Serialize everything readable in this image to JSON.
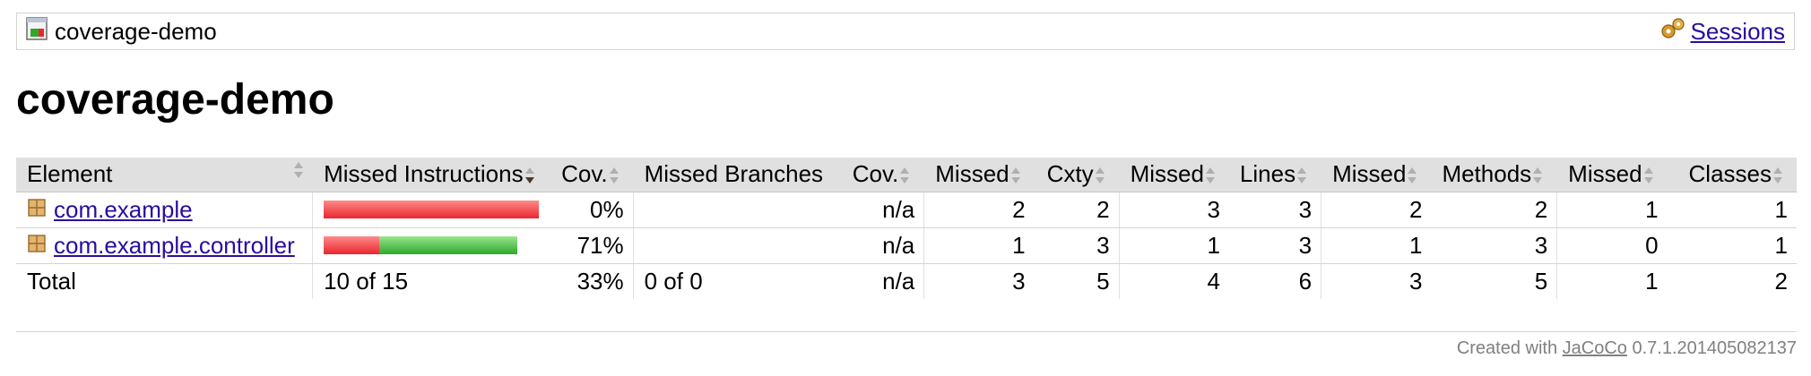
{
  "breadcrumb": {
    "title": "coverage-demo",
    "icon": "report-icon",
    "sessions_label": "Sessions",
    "sessions_icon": "sessions-gear-icon"
  },
  "page_title": "coverage-demo",
  "table": {
    "headers": {
      "element": "Element",
      "missed_instructions": "Missed Instructions",
      "cov_instr": "Cov.",
      "missed_branches": "Missed Branches",
      "cov_branch": "Cov.",
      "missed_cxty": "Missed",
      "cxty": "Cxty",
      "missed_lines": "Missed",
      "lines": "Lines",
      "missed_methods": "Missed",
      "methods": "Methods",
      "missed_classes": "Missed",
      "classes": "Classes"
    },
    "rows": [
      {
        "element": "com.example",
        "icon": "package-icon",
        "instr_missed_fraction": 1.0,
        "cov_instr": "0%",
        "cov_branch": "n/a",
        "missed_cxty": "2",
        "cxty": "2",
        "missed_lines": "3",
        "lines": "3",
        "missed_methods": "2",
        "methods": "2",
        "missed_classes": "1",
        "classes": "1"
      },
      {
        "element": "com.example.controller",
        "icon": "package-icon",
        "instr_missed_fraction": 0.2857,
        "cov_instr": "71%",
        "cov_branch": "n/a",
        "missed_cxty": "1",
        "cxty": "3",
        "missed_lines": "1",
        "lines": "3",
        "missed_methods": "1",
        "methods": "3",
        "missed_classes": "0",
        "classes": "1"
      }
    ],
    "total": {
      "label": "Total",
      "missed_instructions": "10 of 15",
      "cov_instr": "33%",
      "missed_branches": "0 of 0",
      "cov_branch": "n/a",
      "missed_cxty": "3",
      "cxty": "5",
      "missed_lines": "4",
      "lines": "6",
      "missed_methods": "3",
      "methods": "5",
      "missed_classes": "1",
      "classes": "2"
    }
  },
  "footer": {
    "prefix": "Created with",
    "tool": "JaCoCo",
    "version": "0.7.1.201405082137"
  },
  "colors": {
    "link": "#2a0c9f",
    "bar_missed": "#e8272d",
    "bar_covered": "#2ea92a",
    "header_bg": "#e0e0e0"
  }
}
